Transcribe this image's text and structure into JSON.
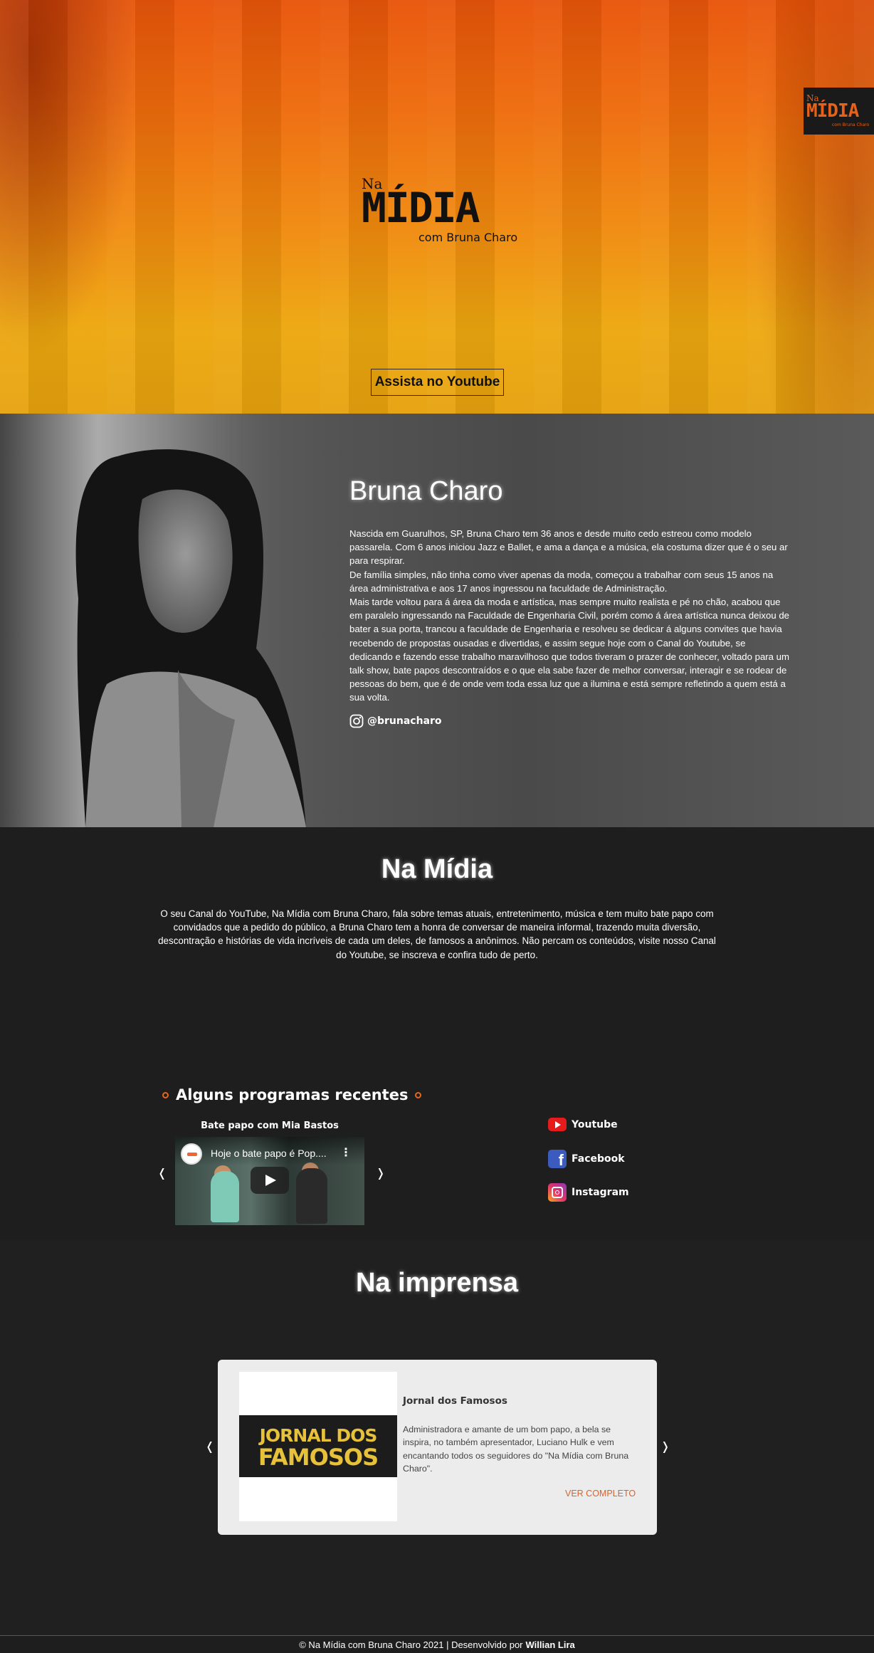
{
  "hero": {
    "logo": {
      "na": "Na",
      "midia": "MÍDIA",
      "com": "com Bruna Charo"
    },
    "corner_logo": {
      "na": "Na",
      "midia": "MÍDIA",
      "com": "com Bruna Charo"
    },
    "cta_label": "Assista no Youtube"
  },
  "about": {
    "name": "Bruna Charo",
    "bio": [
      "Nascida em Guarulhos, SP, Bruna Charo tem 36 anos e desde muito cedo estreou como modelo passarela. Com 6 anos iniciou Jazz e Ballet, e ama a dança e a música, ela costuma dizer que é o seu ar para respirar.",
      "De família simples, não tinha como viver apenas da moda, começou a trabalhar com seus 15 anos na área administrativa e aos 17 anos ingressou na faculdade de Administração.",
      "Mais tarde voltou para á área da moda e artística, mas sempre muito realista e pé no chão, acabou que em paralelo ingressando na Faculdade de Engenharia Civil, porém como á área artística nunca deixou de bater a sua porta, trancou a faculdade de Engenharia e resolveu se dedicar á alguns convites que havia recebendo de propostas ousadas e divertidas, e assim segue hoje com o Canal do Youtube, se dedicando e fazendo esse trabalho maravilhoso que todos tiveram o prazer de conhecer, voltado para um talk show, bate papos descontraídos e o que ela sabe fazer de melhor conversar, interagir e se rodear de pessoas do bem, que é de onde vem toda essa luz que a ilumina e está sempre refletindo a quem está a sua volta."
    ],
    "instagram": "@brunacharo"
  },
  "na_midia": {
    "title": "Na Mídia",
    "text": "O seu Canal do YouTube, Na Mídia com Bruna Charo, fala sobre temas atuais, entretenimento, música e tem muito bate papo com convidados que a pedido do público, a Bruna Charo tem a honra de conversar de maneira informal, trazendo muita diversão, descontração e histórias de vida incríveis de cada um deles, de famosos a anônimos. Não percam os conteúdos, visite nosso Canal do Youtube, se inscreva e confira tudo de perto."
  },
  "recent": {
    "title": "Alguns programas recentes",
    "video_caption": "Bate papo com Mia Bastos",
    "video_title": "Hoje o bate papo é Pop....",
    "prev": "❬",
    "next": "❭"
  },
  "social": {
    "youtube": "Youtube",
    "facebook": "Facebook",
    "instagram": "Instagram"
  },
  "imprensa": {
    "title": "Na imprensa",
    "card": {
      "logo_line1": "JORNAL DOS",
      "logo_line2": "FAMOSOS",
      "title": "Jornal dos Famosos",
      "text": "Administradora e amante de um bom papo, a bela se inspira, no também apresentador, Luciano Hulk e vem encantando todos os seguidores do \"Na Mídia com Bruna Charo\".",
      "more": "VER COMPLETO"
    },
    "prev": "❬",
    "next": "❭"
  },
  "footer": {
    "text": "© Na Mídia com Bruna Charo 2021 | Desenvolvido por",
    "author": "Willian Lira"
  },
  "colors": {
    "accent": "#e8651b",
    "background": "#1e1e1e"
  }
}
